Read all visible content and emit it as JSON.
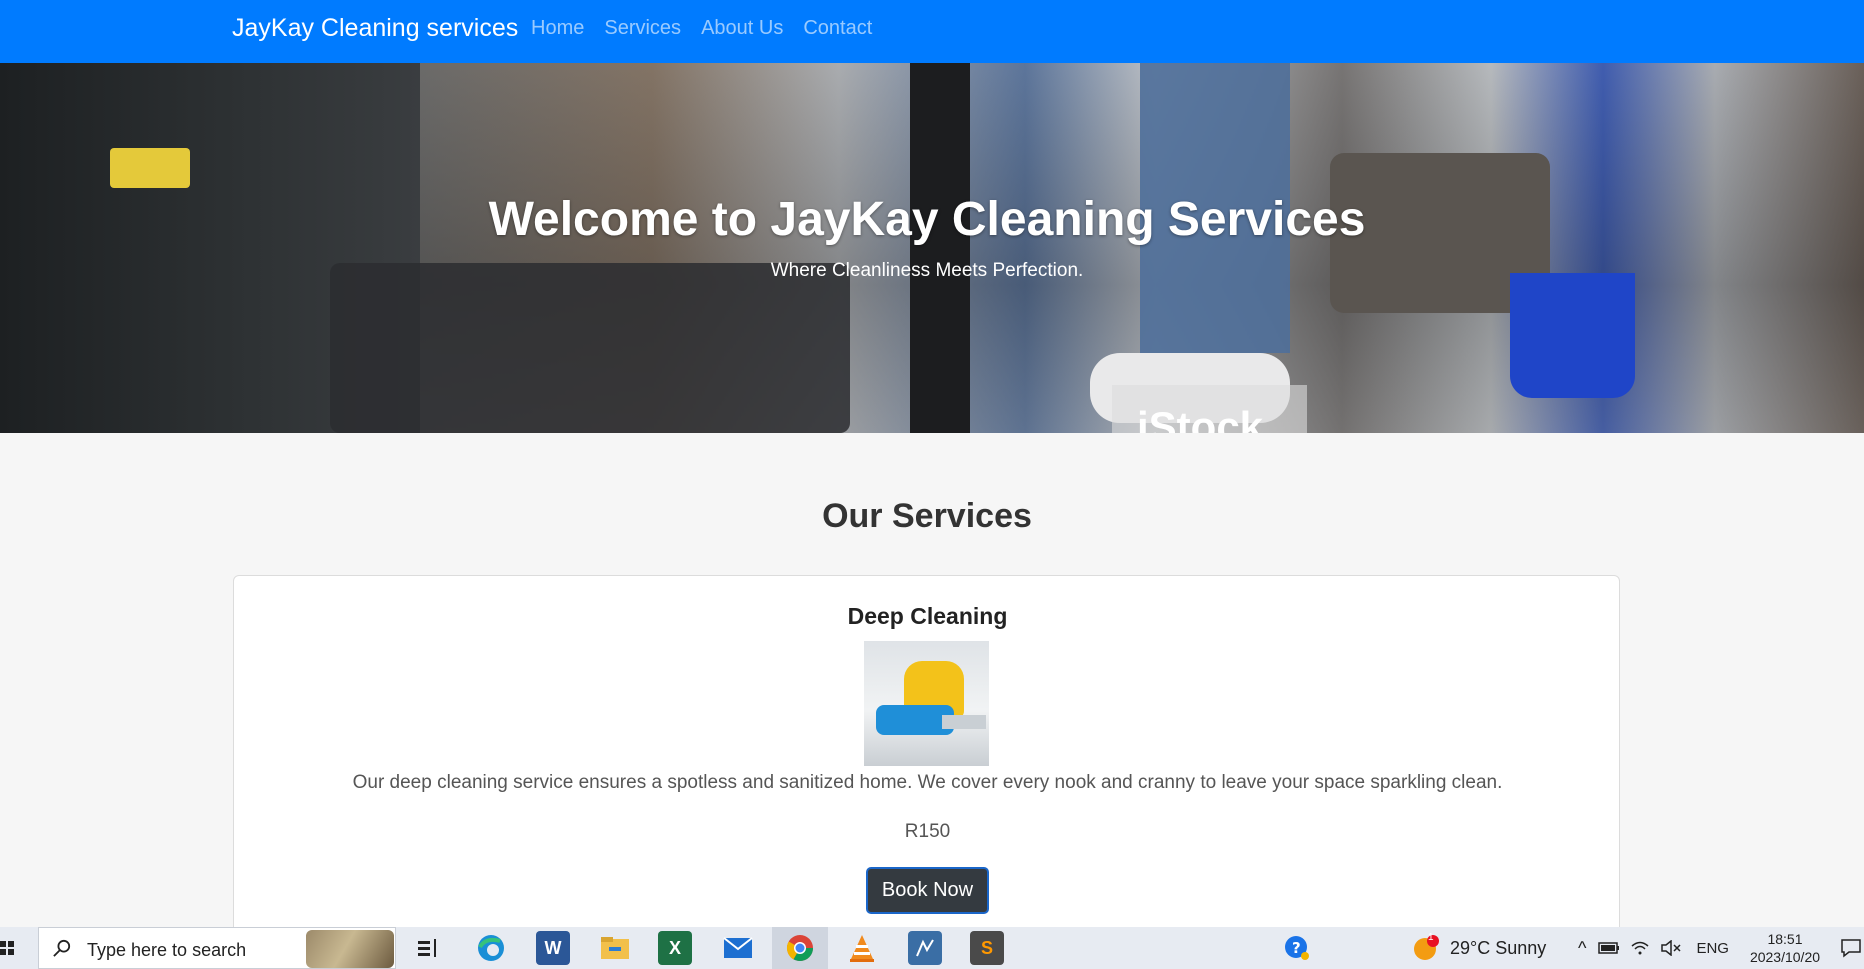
{
  "navbar": {
    "brand": "JayKay Cleaning services",
    "links": [
      "Home",
      "Services",
      "About Us",
      "Contact"
    ]
  },
  "hero": {
    "title": "Welcome to JayKay Cleaning Services",
    "subtitle": "Where Cleanliness Meets Perfection.",
    "watermark": "iStock"
  },
  "services": {
    "heading": "Our Services",
    "cards": [
      {
        "title": "Deep Cleaning",
        "description": "Our deep cleaning service ensures a spotless and sanitized home. We cover every nook and cranny to leave your space sparkling clean.",
        "price": "R150",
        "button": "Book Now"
      }
    ]
  },
  "taskbar": {
    "search_placeholder": "Type here to search",
    "apps": [
      "task-view",
      "edge",
      "word",
      "file-explorer",
      "excel",
      "mail",
      "chrome",
      "vlc",
      "app-blue",
      "sublime-text"
    ],
    "weather_badge": "1",
    "weather": "29°C  Sunny",
    "language": "ENG",
    "time": "18:51",
    "date": "2023/10/20"
  }
}
